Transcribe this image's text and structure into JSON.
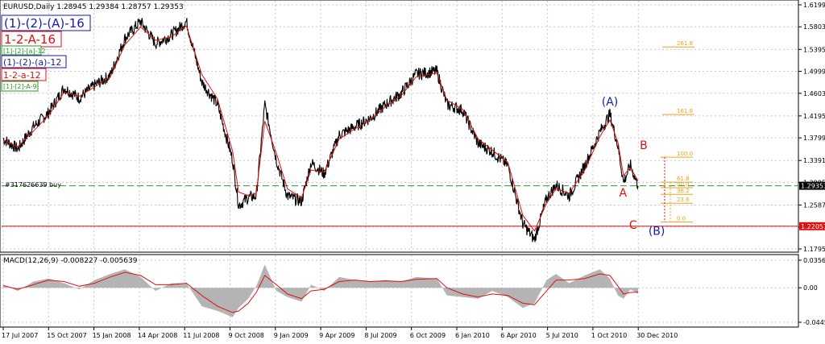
{
  "header": {
    "symbol_line": "EURUSD,Daily  1.28945 1.29384 1.28757 1.29353"
  },
  "wave_legend": [
    {
      "text": "(1)-(2)-(A)-16",
      "color": "#1a1aa8"
    },
    {
      "text": "1-2-A-16",
      "color": "#e01010"
    },
    {
      "text": "[1]-[2]-[a]-12",
      "color": "#2a9a2a"
    },
    {
      "text": "(1)-(2)-(a)-12",
      "color": "#1a1aa8"
    },
    {
      "text": "1-2-a-12",
      "color": "#e01010"
    },
    {
      "text": "[1]-[2]-A-9",
      "color": "#2a9a2a"
    }
  ],
  "order_label": "#317626639 buy",
  "colors": {
    "price": "#000000",
    "ma": "#e01010",
    "grid": "#c8c8c8",
    "fib": "#f0a020",
    "order_line": "#2a9a2a",
    "support_line": "#e01010",
    "wave_blue": "#1a1aa8",
    "wave_red": "#e01010",
    "macd_hist": "#b4b4b4",
    "macd_signal": "#e01010"
  },
  "chart_data": [
    {
      "type": "line",
      "title": "EURUSD,Daily",
      "y_ticks": [
        "1.61990",
        "1.58030",
        "1.53950",
        "1.49990",
        "1.46030",
        "1.41950",
        "1.37990",
        "1.33910",
        "1.29950",
        "1.25870",
        "1.21910",
        "1.17950"
      ],
      "ylim": [
        1.1795,
        1.6199
      ],
      "x_ticks": [
        "17 Jul 2007",
        "15 Oct 2007",
        "15 Jan 2008",
        "14 Apr 2008",
        "11 Jul 2008",
        "9 Oct 2008",
        "9 Jan 2009",
        "9 Apr 2009",
        "8 Jul 2009",
        "6 Oct 2009",
        "6 Jan 2010",
        "6 Apr 2010",
        "5 Jul 2010",
        "1 Oct 2010",
        "30 Dec 2010"
      ],
      "x": [
        "2007-07-17",
        "2007-08-15",
        "2007-09-15",
        "2007-10-15",
        "2007-11-15",
        "2007-12-15",
        "2008-01-15",
        "2008-02-15",
        "2008-03-15",
        "2008-04-15",
        "2008-05-15",
        "2008-06-15",
        "2008-07-15",
        "2008-08-15",
        "2008-09-15",
        "2008-10-15",
        "2008-10-27",
        "2008-11-15",
        "2008-12-01",
        "2008-12-18",
        "2009-01-10",
        "2009-02-01",
        "2009-03-01",
        "2009-03-20",
        "2009-04-15",
        "2009-05-15",
        "2009-06-15",
        "2009-07-15",
        "2009-08-15",
        "2009-09-15",
        "2009-10-15",
        "2009-11-25",
        "2009-12-15",
        "2010-01-15",
        "2010-02-15",
        "2010-03-15",
        "2010-04-15",
        "2010-05-15",
        "2010-06-07",
        "2010-07-01",
        "2010-07-20",
        "2010-08-15",
        "2010-09-15",
        "2010-10-15",
        "2010-11-04",
        "2010-11-20",
        "2010-12-01",
        "2010-12-15",
        "2010-12-30"
      ],
      "series": [
        {
          "values": [
            1.378,
            1.36,
            1.4,
            1.425,
            1.47,
            1.452,
            1.475,
            1.493,
            1.56,
            1.59,
            1.55,
            1.565,
            1.59,
            1.48,
            1.44,
            1.34,
            1.258,
            1.272,
            1.275,
            1.44,
            1.34,
            1.275,
            1.265,
            1.335,
            1.315,
            1.385,
            1.4,
            1.415,
            1.44,
            1.46,
            1.495,
            1.5,
            1.44,
            1.43,
            1.37,
            1.355,
            1.33,
            1.225,
            1.196,
            1.27,
            1.295,
            1.275,
            1.33,
            1.39,
            1.423,
            1.365,
            1.3,
            1.33,
            1.2935
          ]
        },
        {
          "values": [
            1.376,
            1.364,
            1.392,
            1.42,
            1.462,
            1.455,
            1.472,
            1.49,
            1.548,
            1.58,
            1.556,
            1.562,
            1.582,
            1.494,
            1.45,
            1.356,
            1.282,
            1.276,
            1.28,
            1.41,
            1.352,
            1.288,
            1.272,
            1.322,
            1.318,
            1.378,
            1.396,
            1.412,
            1.436,
            1.456,
            1.49,
            1.497,
            1.448,
            1.432,
            1.378,
            1.358,
            1.336,
            1.24,
            1.212,
            1.262,
            1.288,
            1.28,
            1.322,
            1.382,
            1.412,
            1.372,
            1.312,
            1.326,
            1.302
          ]
        }
      ],
      "annotations": [
        {
          "text": "(A)",
          "color": "#1a1aa8",
          "x": "2010-11-04",
          "y": 1.438
        },
        {
          "text": "B",
          "color": "#e01010",
          "x": "2011-01-10",
          "y": 1.36
        },
        {
          "text": "A",
          "color": "#e01010",
          "x": "2010-11-30",
          "y": 1.274
        },
        {
          "text": "C",
          "color": "#e01010",
          "x": "2010-12-20",
          "y": 1.216
        },
        {
          "text": "(B)",
          "color": "#1a1aa8",
          "x": "2011-02-05",
          "y": 1.205
        }
      ],
      "fib_levels": [
        {
          "label": "261.8",
          "y": 1.544
        },
        {
          "label": "161.8",
          "y": 1.422
        },
        {
          "label": "100.0",
          "y": 1.345
        },
        {
          "label": "61.8",
          "y": 1.3
        },
        {
          "label": "50.0",
          "y": 1.29
        },
        {
          "label": "38.2",
          "y": 1.278
        },
        {
          "label": "23.6",
          "y": 1.262
        },
        {
          "label": "0.0",
          "y": 1.228
        }
      ],
      "order_level": 1.2935,
      "support_level": 1.22051,
      "price_badges": [
        {
          "label": "1.29353",
          "y": 1.2935,
          "bg": "#000000"
        },
        {
          "label": "1.22051",
          "y": 1.22051,
          "bg": "#e01010"
        }
      ],
      "grid": true
    },
    {
      "type": "line",
      "title": "MACD(12,26,9) -0.008227 -0.005639",
      "y_ticks": [
        "0.035670",
        "0.00",
        "-0.044590"
      ],
      "ylim": [
        -0.04459,
        0.03567
      ],
      "x": [
        "2007-07-17",
        "2007-08-15",
        "2007-09-15",
        "2007-10-15",
        "2007-11-15",
        "2007-12-15",
        "2008-01-15",
        "2008-02-15",
        "2008-03-15",
        "2008-04-15",
        "2008-05-15",
        "2008-06-15",
        "2008-07-15",
        "2008-08-15",
        "2008-09-15",
        "2008-10-15",
        "2008-10-27",
        "2008-11-15",
        "2008-12-01",
        "2008-12-18",
        "2009-01-10",
        "2009-02-01",
        "2009-03-01",
        "2009-03-20",
        "2009-04-15",
        "2009-05-15",
        "2009-06-15",
        "2009-07-15",
        "2009-08-15",
        "2009-09-15",
        "2009-10-15",
        "2009-11-25",
        "2009-12-15",
        "2010-01-15",
        "2010-02-15",
        "2010-03-15",
        "2010-04-15",
        "2010-05-15",
        "2010-06-07",
        "2010-07-01",
        "2010-07-20",
        "2010-08-15",
        "2010-09-15",
        "2010-10-15",
        "2010-11-04",
        "2010-11-20",
        "2010-12-01",
        "2010-12-15",
        "2010-12-30"
      ],
      "series": [
        {
          "values": [
            0.004,
            -0.004,
            0.008,
            0.012,
            0.006,
            -0.002,
            0.01,
            0.018,
            0.024,
            0.014,
            -0.004,
            0.006,
            0.006,
            -0.024,
            -0.03,
            -0.038,
            -0.026,
            -0.014,
            0.002,
            0.03,
            -0.004,
            -0.012,
            -0.018,
            0.004,
            -0.004,
            0.014,
            0.01,
            0.008,
            0.01,
            0.008,
            0.014,
            0.012,
            -0.01,
            -0.012,
            -0.014,
            -0.004,
            -0.012,
            -0.026,
            -0.02,
            0.01,
            0.018,
            0.006,
            0.016,
            0.024,
            0.012,
            -0.01,
            -0.014,
            -0.002,
            -0.008
          ]
        },
        {
          "values": [
            0.003,
            -0.002,
            0.004,
            0.01,
            0.008,
            0.002,
            0.006,
            0.014,
            0.02,
            0.016,
            0.004,
            0.004,
            0.006,
            -0.01,
            -0.024,
            -0.032,
            -0.03,
            -0.02,
            -0.006,
            0.016,
            0.004,
            -0.008,
            -0.014,
            -0.004,
            -0.002,
            0.008,
            0.01,
            0.008,
            0.009,
            0.008,
            0.011,
            0.012,
            0.0,
            -0.008,
            -0.012,
            -0.008,
            -0.01,
            -0.02,
            -0.022,
            -0.004,
            0.01,
            0.01,
            0.012,
            0.018,
            0.016,
            0.002,
            -0.008,
            -0.006,
            -0.0056
          ]
        }
      ],
      "grid": true
    }
  ]
}
